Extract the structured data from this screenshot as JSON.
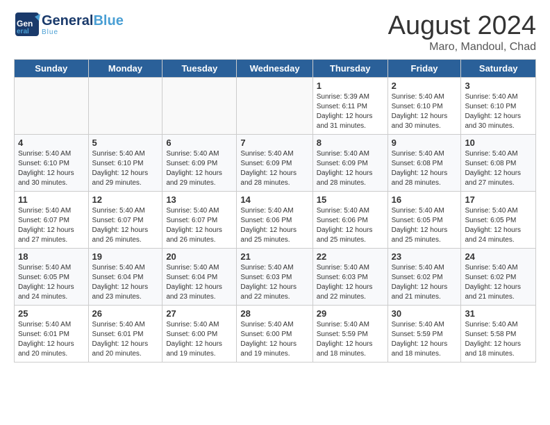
{
  "logo": {
    "line1a": "General",
    "line1b": "Blue",
    "line2": "Blue"
  },
  "header": {
    "month_year": "August 2024",
    "location": "Maro, Mandoul, Chad"
  },
  "days_of_week": [
    "Sunday",
    "Monday",
    "Tuesday",
    "Wednesday",
    "Thursday",
    "Friday",
    "Saturday"
  ],
  "weeks": [
    [
      {
        "num": "",
        "info": "",
        "empty": true
      },
      {
        "num": "",
        "info": "",
        "empty": true
      },
      {
        "num": "",
        "info": "",
        "empty": true
      },
      {
        "num": "",
        "info": "",
        "empty": true
      },
      {
        "num": "1",
        "info": "Sunrise: 5:39 AM\nSunset: 6:11 PM\nDaylight: 12 hours\nand 31 minutes."
      },
      {
        "num": "2",
        "info": "Sunrise: 5:40 AM\nSunset: 6:10 PM\nDaylight: 12 hours\nand 30 minutes."
      },
      {
        "num": "3",
        "info": "Sunrise: 5:40 AM\nSunset: 6:10 PM\nDaylight: 12 hours\nand 30 minutes."
      }
    ],
    [
      {
        "num": "4",
        "info": "Sunrise: 5:40 AM\nSunset: 6:10 PM\nDaylight: 12 hours\nand 30 minutes."
      },
      {
        "num": "5",
        "info": "Sunrise: 5:40 AM\nSunset: 6:10 PM\nDaylight: 12 hours\nand 29 minutes."
      },
      {
        "num": "6",
        "info": "Sunrise: 5:40 AM\nSunset: 6:09 PM\nDaylight: 12 hours\nand 29 minutes."
      },
      {
        "num": "7",
        "info": "Sunrise: 5:40 AM\nSunset: 6:09 PM\nDaylight: 12 hours\nand 28 minutes."
      },
      {
        "num": "8",
        "info": "Sunrise: 5:40 AM\nSunset: 6:09 PM\nDaylight: 12 hours\nand 28 minutes."
      },
      {
        "num": "9",
        "info": "Sunrise: 5:40 AM\nSunset: 6:08 PM\nDaylight: 12 hours\nand 28 minutes."
      },
      {
        "num": "10",
        "info": "Sunrise: 5:40 AM\nSunset: 6:08 PM\nDaylight: 12 hours\nand 27 minutes."
      }
    ],
    [
      {
        "num": "11",
        "info": "Sunrise: 5:40 AM\nSunset: 6:07 PM\nDaylight: 12 hours\nand 27 minutes."
      },
      {
        "num": "12",
        "info": "Sunrise: 5:40 AM\nSunset: 6:07 PM\nDaylight: 12 hours\nand 26 minutes."
      },
      {
        "num": "13",
        "info": "Sunrise: 5:40 AM\nSunset: 6:07 PM\nDaylight: 12 hours\nand 26 minutes."
      },
      {
        "num": "14",
        "info": "Sunrise: 5:40 AM\nSunset: 6:06 PM\nDaylight: 12 hours\nand 25 minutes."
      },
      {
        "num": "15",
        "info": "Sunrise: 5:40 AM\nSunset: 6:06 PM\nDaylight: 12 hours\nand 25 minutes."
      },
      {
        "num": "16",
        "info": "Sunrise: 5:40 AM\nSunset: 6:05 PM\nDaylight: 12 hours\nand 25 minutes."
      },
      {
        "num": "17",
        "info": "Sunrise: 5:40 AM\nSunset: 6:05 PM\nDaylight: 12 hours\nand 24 minutes."
      }
    ],
    [
      {
        "num": "18",
        "info": "Sunrise: 5:40 AM\nSunset: 6:05 PM\nDaylight: 12 hours\nand 24 minutes."
      },
      {
        "num": "19",
        "info": "Sunrise: 5:40 AM\nSunset: 6:04 PM\nDaylight: 12 hours\nand 23 minutes."
      },
      {
        "num": "20",
        "info": "Sunrise: 5:40 AM\nSunset: 6:04 PM\nDaylight: 12 hours\nand 23 minutes."
      },
      {
        "num": "21",
        "info": "Sunrise: 5:40 AM\nSunset: 6:03 PM\nDaylight: 12 hours\nand 22 minutes."
      },
      {
        "num": "22",
        "info": "Sunrise: 5:40 AM\nSunset: 6:03 PM\nDaylight: 12 hours\nand 22 minutes."
      },
      {
        "num": "23",
        "info": "Sunrise: 5:40 AM\nSunset: 6:02 PM\nDaylight: 12 hours\nand 21 minutes."
      },
      {
        "num": "24",
        "info": "Sunrise: 5:40 AM\nSunset: 6:02 PM\nDaylight: 12 hours\nand 21 minutes."
      }
    ],
    [
      {
        "num": "25",
        "info": "Sunrise: 5:40 AM\nSunset: 6:01 PM\nDaylight: 12 hours\nand 20 minutes."
      },
      {
        "num": "26",
        "info": "Sunrise: 5:40 AM\nSunset: 6:01 PM\nDaylight: 12 hours\nand 20 minutes."
      },
      {
        "num": "27",
        "info": "Sunrise: 5:40 AM\nSunset: 6:00 PM\nDaylight: 12 hours\nand 19 minutes."
      },
      {
        "num": "28",
        "info": "Sunrise: 5:40 AM\nSunset: 6:00 PM\nDaylight: 12 hours\nand 19 minutes."
      },
      {
        "num": "29",
        "info": "Sunrise: 5:40 AM\nSunset: 5:59 PM\nDaylight: 12 hours\nand 18 minutes."
      },
      {
        "num": "30",
        "info": "Sunrise: 5:40 AM\nSunset: 5:59 PM\nDaylight: 12 hours\nand 18 minutes."
      },
      {
        "num": "31",
        "info": "Sunrise: 5:40 AM\nSunset: 5:58 PM\nDaylight: 12 hours\nand 18 minutes."
      }
    ]
  ]
}
